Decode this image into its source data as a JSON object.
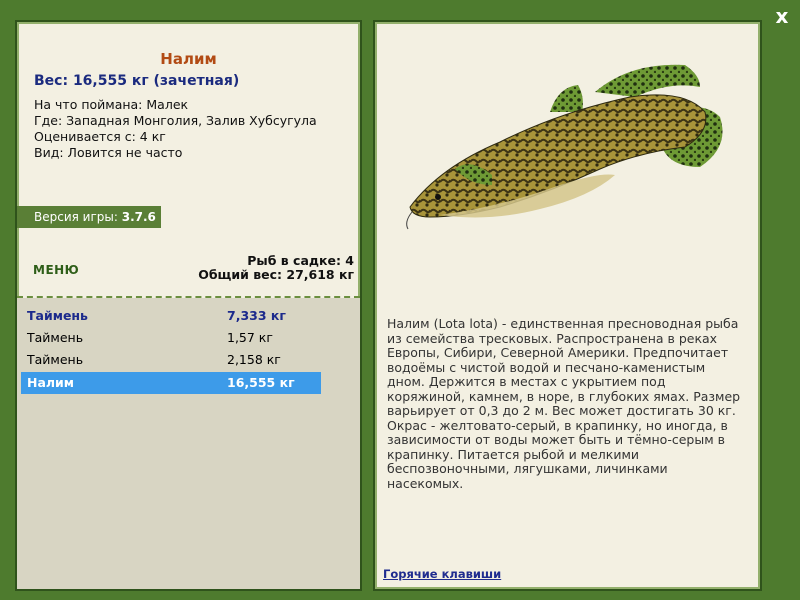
{
  "window": {
    "close_label": "x"
  },
  "fish": {
    "name": "Налим",
    "weight_line": "Вес: 16,555 кг (зачетная)",
    "info": [
      {
        "label": "На что поймана:",
        "value": "Малек"
      },
      {
        "label": "Где:",
        "value": "Западная Монголия, Залив Хубсугула"
      },
      {
        "label": "Оценивается с:",
        "value": "4 кг"
      },
      {
        "label": "Вид:",
        "value": "Ловится не часто"
      }
    ]
  },
  "version": {
    "label": "Версия игры:",
    "value": "3.7.6"
  },
  "menu": {
    "label": "МЕНЮ"
  },
  "cage": {
    "count_line": "Рыб в садке: 4",
    "total_line": "Общий вес: 27,618 кг"
  },
  "catch_list": [
    {
      "name": "Таймень",
      "weight": "7,333 кг",
      "style": "bold"
    },
    {
      "name": "Таймень",
      "weight": "1,57 кг",
      "style": "normal"
    },
    {
      "name": "Таймень",
      "weight": "2,158 кг",
      "style": "normal"
    },
    {
      "name": "Налим",
      "weight": "16,555 кг",
      "style": "selected"
    }
  ],
  "description": "Налим (Lota lota) - единственная пресноводная рыба из семейства тресковых. Распространена в реках Европы, Сибири, Северной Америки. Предпочитает водоёмы с чистой водой и песчано-каменистым дном. Держится в местах с укрытием под коряжиной, камнем, в норе, в глубоких ямах. Размер варьирует от 0,3 до 2 м. Вес может достигать 30 кг. Окрас - желтовато-серый, в крапинку, но иногда, в зависимости от воды может быть и тёмно-серым в крапинку. Питается рыбой и мелкими беспозвоночными, лягушками, личинками насекомых.",
  "hotkeys_label": "Горячие клавиши",
  "colors": {
    "frame": "#4e7b2e",
    "panel": "#f3f0e2",
    "accent_title": "#b24b14",
    "link": "#1f2c8f",
    "selected_row": "#3d9be9"
  },
  "icons": {
    "close": "close-icon",
    "fish": "burbot-fish-image"
  }
}
